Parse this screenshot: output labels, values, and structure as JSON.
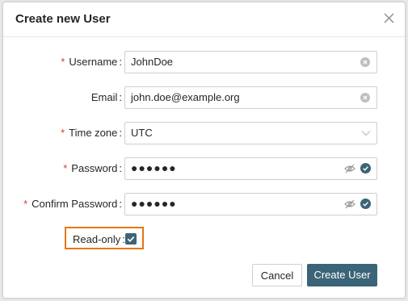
{
  "dialog": {
    "title": "Create new User"
  },
  "form": {
    "required_mark": "*",
    "colon": ":",
    "username": {
      "label": "Username",
      "value": "JohnDoe"
    },
    "email": {
      "label": "Email",
      "value": "john.doe@example.org"
    },
    "timezone": {
      "label": "Time zone",
      "value": "UTC"
    },
    "password": {
      "label": "Password",
      "value": "●●●●●●"
    },
    "confirm_password": {
      "label": "Confirm Password",
      "value": "●●●●●●"
    },
    "readonly": {
      "label": "Read-only",
      "checked": true
    }
  },
  "buttons": {
    "cancel": "Cancel",
    "create": "Create User"
  },
  "icons": {
    "close": "close-icon",
    "clear": "clear-icon",
    "dropdown": "chevron-down-icon",
    "visibility": "eye-off-icon",
    "valid": "check-circle-icon",
    "checkbox": "checkmark-icon"
  },
  "colors": {
    "primary": "#3b6478",
    "required": "#e0362f",
    "highlight": "#e87611"
  }
}
